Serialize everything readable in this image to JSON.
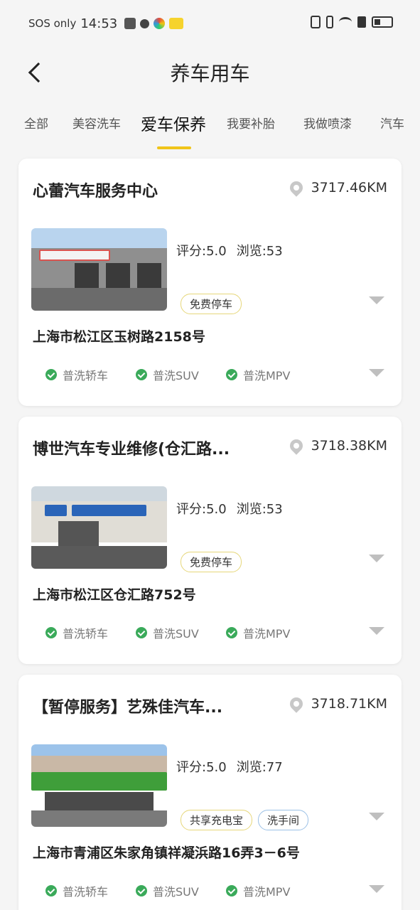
{
  "status_bar": {
    "carrier": "SOS only",
    "time": "14:53"
  },
  "header": {
    "title": "养车用车"
  },
  "tabs": [
    {
      "label": "全部"
    },
    {
      "label": "美容洗车"
    },
    {
      "label": "爱车保养"
    },
    {
      "label": "我要补胎"
    },
    {
      "label": "我做喷漆"
    },
    {
      "label": "汽车"
    }
  ],
  "active_tab": "爱车保养",
  "accent_color": "#f0c419",
  "shops": [
    {
      "name": "心蕾汽车服务中心",
      "distance": "3717.46KM",
      "rating": "评分:5.0",
      "views": "浏览:53",
      "tags": [
        "免费停车"
      ],
      "address": "上海市松江区玉树路2158号",
      "services": [
        "普洗轿车",
        "普洗SUV",
        "普洗MPV"
      ],
      "image_icon": "shop-photo"
    },
    {
      "name": "博世汽车专业维修(仓汇路...",
      "distance": "3718.38KM",
      "rating": "评分:5.0",
      "views": "浏览:53",
      "tags": [
        "免费停车"
      ],
      "address": "上海市松江区仓汇路752号",
      "services": [
        "普洗轿车",
        "普洗SUV",
        "普洗MPV"
      ],
      "image_icon": "shop-photo"
    },
    {
      "name": "【暂停服务】艺殊佳汽车...",
      "distance": "3718.71KM",
      "rating": "评分:5.0",
      "views": "浏览:77",
      "tags": [
        "共享充电宝",
        "洗手间"
      ],
      "address": "上海市青浦区朱家角镇祥凝浜路16弄3－6号",
      "services": [
        "普洗轿车",
        "普洗SUV",
        "普洗MPV"
      ],
      "image_icon": "shop-photo"
    }
  ]
}
